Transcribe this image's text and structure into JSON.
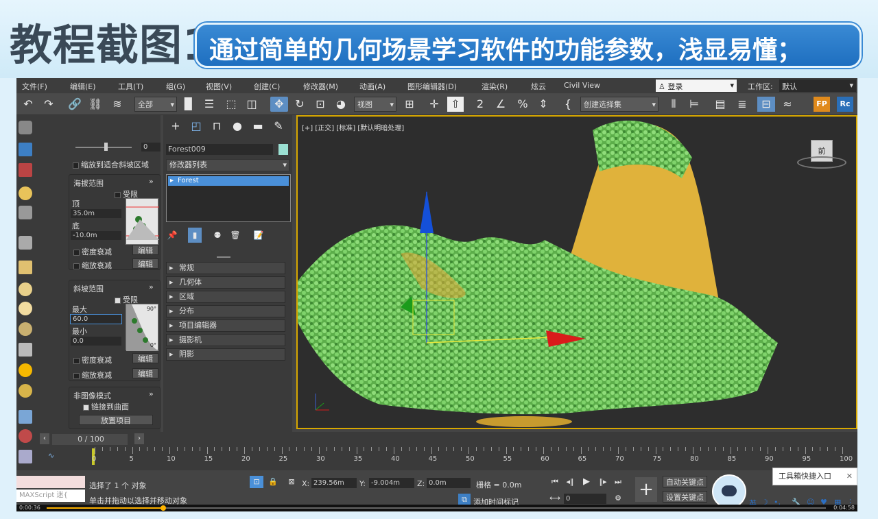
{
  "banner": {
    "title": "教程截图1",
    "subtitle": "通过简单的几何场景学习软件的功能参数，浅显易懂；"
  },
  "menu": {
    "items": [
      "文件(F)",
      "编辑(E)",
      "工具(T)",
      "组(G)",
      "视图(V)",
      "创建(C)",
      "修改器(M)",
      "动画(A)",
      "图形编辑器(D)",
      "渲染(R)",
      "炫云",
      "Civil View"
    ],
    "login": "登录",
    "workarea_label": "工作区:",
    "workarea_value": "默认"
  },
  "toolbar": {
    "filter": "全部",
    "view": "视图",
    "selset": "创建选择集"
  },
  "command_panel": {
    "slider_value": "0",
    "fit_slope": "缩放到适合斜坡区域",
    "altitude": {
      "title": "海拔范围",
      "limit": "受限",
      "top_label": "顶",
      "top_value": "35.0m",
      "bottom_label": "底",
      "bottom_value": "-10.0m"
    },
    "density_falloff": "密度衰减",
    "scale_falloff": "缩放衰减",
    "edit": "编辑",
    "slope": {
      "title": "斜坡范围",
      "limit": "受限",
      "max_label": "最大",
      "max_value": "60.0",
      "min_label": "最小",
      "min_value": "0.0",
      "angle_top": "90°",
      "angle_bottom": "0°"
    },
    "non_image": {
      "title": "非图像模式",
      "link": "链接到曲面",
      "place": "放置项目"
    }
  },
  "modify_panel": {
    "object_name": "Forest009",
    "object_color": "#9be0d3",
    "modifier_list": "修改器列表",
    "stack_item": "Forest",
    "rollouts": [
      "常规",
      "几何体",
      "区域",
      "分布",
      "项目编辑器",
      "摄影机",
      "阴影"
    ]
  },
  "viewport": {
    "label": "[+] [正交] [标准] [默认明暗处理]",
    "cube_label": "前"
  },
  "timeline": {
    "frame": "0 / 100",
    "ticks": [
      "0",
      "5",
      "10",
      "15",
      "20",
      "25",
      "30",
      "35",
      "40",
      "45",
      "50",
      "55",
      "60",
      "65",
      "70",
      "75",
      "80",
      "85",
      "90",
      "95",
      "100"
    ]
  },
  "status": {
    "maxscript": "MAXScript 迷{",
    "selected": "选择了 1 个 对象",
    "hint": "单击并拖动以选择并移动对象",
    "x_label": "X:",
    "x": "239.56m",
    "y_label": "Y:",
    "y": "-9.004m",
    "z_label": "Z:",
    "z": "0.0m",
    "grid": "栅格 = 0.0m",
    "auto_key": "自动关键点",
    "set_key": "设置关键点",
    "add_time_tag": "添加时间标记",
    "frame_field": "0",
    "lang": "英"
  },
  "tooltip": "工具箱快捷入口",
  "video": {
    "elapsed": "0:00:36",
    "total": "0:04:58",
    "progress": 0.15
  }
}
